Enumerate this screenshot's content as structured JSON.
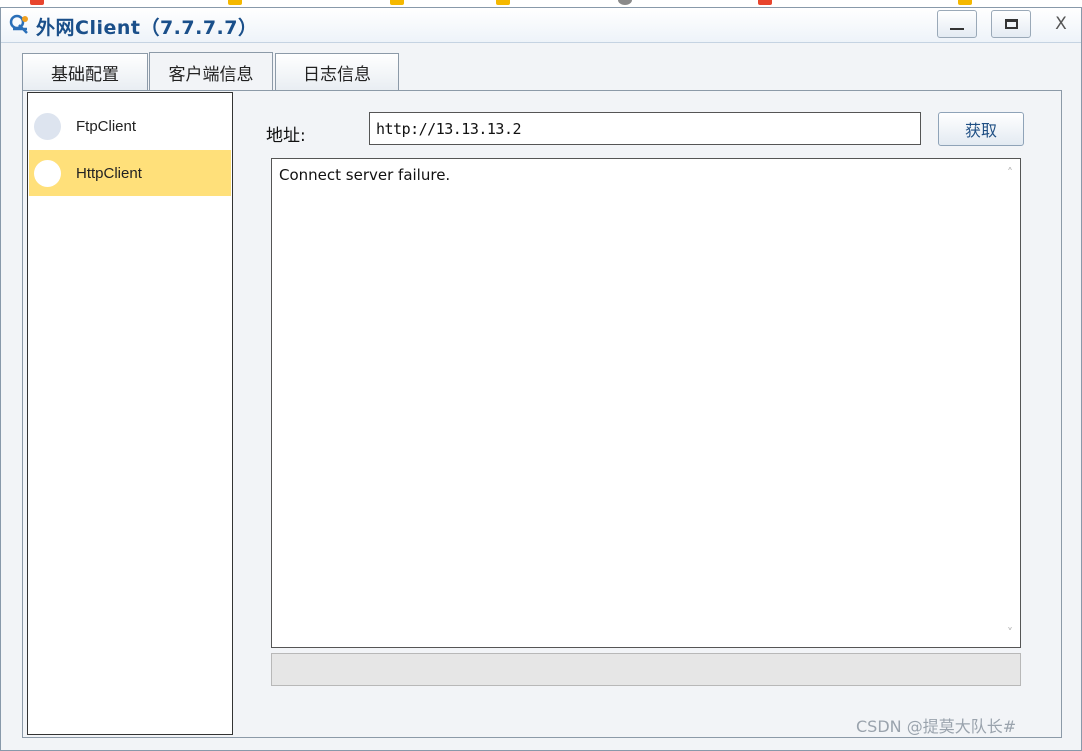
{
  "window": {
    "title": "外网Client（7.7.7.7）",
    "controls": {
      "minimize": "minimize",
      "maximize": "maximize",
      "close": "X"
    }
  },
  "tabs": [
    {
      "label": "基础配置",
      "active": false
    },
    {
      "label": "客户端信息",
      "active": true
    },
    {
      "label": "日志信息",
      "active": false
    }
  ],
  "clients": [
    {
      "label": "FtpClient",
      "selected": false
    },
    {
      "label": "HttpClient",
      "selected": true
    }
  ],
  "address": {
    "label": "地址:",
    "value": "http://13.13.13.2"
  },
  "fetch_button": {
    "label": "获取"
  },
  "output": {
    "text": "Connect server failure."
  },
  "watermark": "CSDN @提莫大队长#",
  "colors": {
    "selection": "#ffe07a",
    "title": "#1a4f8a",
    "button_text": "#1f4f84"
  }
}
